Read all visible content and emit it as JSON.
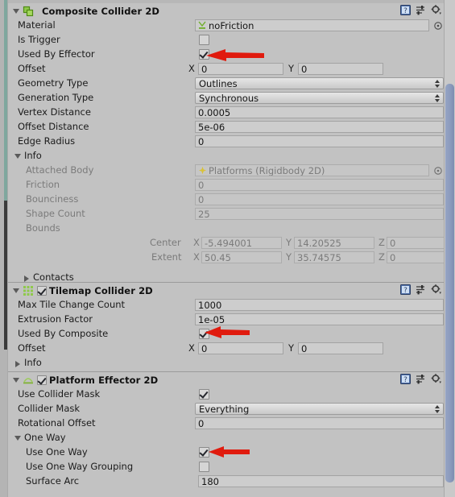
{
  "window": {
    "scrollbar_present": true,
    "accent_color": "#7fa79e",
    "background": "#c2c2c2",
    "annotation_color": "#e01b0e"
  },
  "header_icons": {
    "help": "help-book-icon",
    "preset": "preset-slider-icon",
    "settings": "gear-icon"
  },
  "components": [
    {
      "name": "composite-collider-2d",
      "title": "Composite Collider 2D",
      "icon": "composite-collider-icon",
      "has_enable_checkbox": false,
      "expanded": true,
      "rows": [
        {
          "label": "Material",
          "type": "object",
          "value": "noFriction",
          "icon": "physics-material-2d-icon",
          "dim": false
        },
        {
          "label": "Is Trigger",
          "type": "checkbox",
          "checked": false
        },
        {
          "label": "Used By Effector",
          "type": "checkbox",
          "checked": true,
          "annotated": true
        },
        {
          "label": "Offset",
          "type": "vector2",
          "x": "0",
          "y": "0"
        },
        {
          "label": "Geometry Type",
          "type": "popup",
          "value": "Outlines"
        },
        {
          "label": "Generation Type",
          "type": "popup",
          "value": "Synchronous"
        },
        {
          "label": "Vertex Distance",
          "type": "text",
          "value": "0.0005"
        },
        {
          "label": "Offset Distance",
          "type": "text",
          "value": "5e-06"
        },
        {
          "label": "Edge Radius",
          "type": "text",
          "value": "0"
        },
        {
          "label": "Info",
          "type": "foldout",
          "expanded": true
        },
        {
          "label": "Attached Body",
          "type": "object",
          "value": "Platforms (Rigidbody 2D)",
          "icon": "rigidbody-2d-icon",
          "dim": true
        },
        {
          "label": "Friction",
          "type": "text",
          "value": "0",
          "dim": true
        },
        {
          "label": "Bounciness",
          "type": "text",
          "value": "0",
          "dim": true
        },
        {
          "label": "Shape Count",
          "type": "text",
          "value": "25",
          "dim": true
        },
        {
          "label": "Bounds",
          "type": "bounds",
          "dim": true,
          "center": {
            "name": "Center",
            "x": "-5.494001",
            "y": "14.20525",
            "z": "0"
          },
          "extent": {
            "name": "Extent",
            "x": "50.45",
            "y": "35.74575",
            "z": "0"
          }
        },
        {
          "label": "Contacts",
          "type": "foldout",
          "expanded": false
        }
      ]
    },
    {
      "name": "tilemap-collider-2d",
      "title": "Tilemap Collider 2D",
      "icon": "tilemap-collider-icon",
      "has_enable_checkbox": true,
      "enabled": true,
      "expanded": true,
      "rows": [
        {
          "label": "Max Tile Change Count",
          "type": "text",
          "value": "1000"
        },
        {
          "label": "Extrusion Factor",
          "type": "text",
          "value": "1e-05"
        },
        {
          "label": "Used By Composite",
          "type": "checkbox",
          "checked": true,
          "annotated": true
        },
        {
          "label": "Offset",
          "type": "vector2",
          "x": "0",
          "y": "0"
        },
        {
          "label": "Info",
          "type": "foldout",
          "expanded": false
        }
      ]
    },
    {
      "name": "platform-effector-2d",
      "title": "Platform Effector 2D",
      "icon": "platform-effector-icon",
      "has_enable_checkbox": true,
      "enabled": true,
      "expanded": true,
      "rows": [
        {
          "label": "Use Collider Mask",
          "type": "checkbox",
          "checked": true
        },
        {
          "label": "Collider Mask",
          "type": "popup",
          "value": "Everything"
        },
        {
          "label": "Rotational Offset",
          "type": "text",
          "value": "0"
        },
        {
          "label": "One Way",
          "type": "foldout",
          "expanded": true
        },
        {
          "label": "Use One Way",
          "type": "checkbox",
          "checked": true,
          "annotated": true,
          "indent": true
        },
        {
          "label": "Use One Way Grouping",
          "type": "checkbox",
          "checked": false,
          "indent": true
        },
        {
          "label": "Surface Arc",
          "type": "text",
          "value": "180",
          "indent": true
        }
      ]
    }
  ],
  "axis_labels": {
    "x": "X",
    "y": "Y",
    "z": "Z"
  }
}
